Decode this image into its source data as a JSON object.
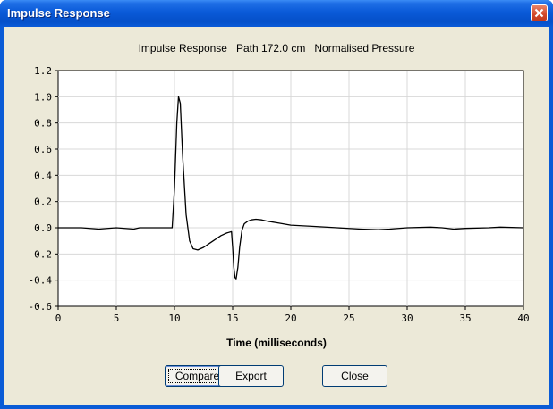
{
  "window": {
    "title": "Impulse Response"
  },
  "chart_data": {
    "type": "line",
    "title": "Impulse Response   Path 172.0 cm   Normalised Pressure",
    "xlabel": "Time (milliseconds)",
    "ylabel": "",
    "xlim": [
      0,
      40
    ],
    "ylim": [
      -0.6,
      1.2
    ],
    "xticks": [
      "0",
      "5",
      "10",
      "15",
      "20",
      "25",
      "30",
      "35",
      "40"
    ],
    "yticks": [
      "1.2",
      "1.0",
      "0.8",
      "0.6",
      "0.4",
      "0.2",
      "0.0",
      "-0.2",
      "-0.4",
      "-0.6"
    ],
    "grid": true,
    "series": [
      {
        "color": "#000000",
        "x": [
          0,
          2,
          3.5,
          5,
          6.5,
          7,
          8,
          9,
          9.8,
          10.0,
          10.2,
          10.35,
          10.5,
          10.7,
          11.0,
          11.3,
          11.6,
          12.0,
          12.5,
          13.0,
          13.5,
          14.0,
          14.5,
          14.9,
          15.0,
          15.1,
          15.2,
          15.3,
          15.45,
          15.6,
          15.8,
          16.0,
          16.3,
          16.6,
          17.0,
          17.5,
          18,
          19,
          20,
          22,
          24,
          26,
          27.5,
          28.5,
          30,
          32,
          33,
          34,
          35,
          37,
          38,
          40
        ],
        "y": [
          0.0,
          0.0,
          -0.01,
          0.0,
          -0.01,
          0.0,
          0.0,
          0.0,
          0.0,
          0.3,
          0.8,
          1.0,
          0.95,
          0.55,
          0.1,
          -0.1,
          -0.16,
          -0.17,
          -0.15,
          -0.12,
          -0.09,
          -0.06,
          -0.04,
          -0.03,
          -0.15,
          -0.3,
          -0.38,
          -0.39,
          -0.3,
          -0.15,
          -0.02,
          0.03,
          0.05,
          0.06,
          0.065,
          0.06,
          0.05,
          0.035,
          0.02,
          0.01,
          0.0,
          -0.01,
          -0.015,
          -0.01,
          0.0,
          0.005,
          0.0,
          -0.01,
          -0.005,
          0.0,
          0.005,
          0.0
        ]
      }
    ]
  },
  "buttons": {
    "compare": "Compare",
    "export": "Export",
    "close": "Close"
  },
  "icons": {
    "close": "close-x-icon"
  }
}
